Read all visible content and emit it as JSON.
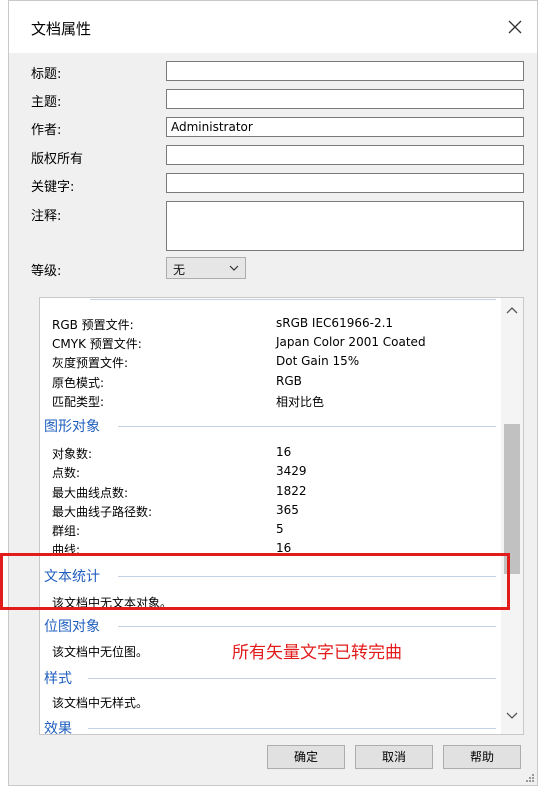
{
  "dialog": {
    "title": "文档属性"
  },
  "fields": {
    "title_label": "标题:",
    "subject_label": "主题:",
    "author_label": "作者:",
    "author_value": "Administrator",
    "copyright_label": "版权所有",
    "keywords_label": "关键字:",
    "comment_label": "注释:",
    "rating_label": "等级:",
    "rating_value": "无"
  },
  "stats": {
    "color": {
      "rows": [
        {
          "label": "RGB 预置文件:",
          "value": "sRGB IEC61966-2.1"
        },
        {
          "label": "CMYK 预置文件:",
          "value": "Japan Color 2001 Coated"
        },
        {
          "label": "灰度预置文件:",
          "value": "Dot Gain 15%"
        },
        {
          "label": "原色模式:",
          "value": "RGB"
        },
        {
          "label": "匹配类型:",
          "value": "相对比色"
        }
      ]
    },
    "graphics": {
      "header": "图形对象",
      "rows": [
        {
          "label": "对象数:",
          "value": "16"
        },
        {
          "label": "点数:",
          "value": "3429"
        },
        {
          "label": "最大曲线点数:",
          "value": "1822"
        },
        {
          "label": "最大曲线子路径数:",
          "value": "365"
        },
        {
          "label": "群组:",
          "value": "5"
        },
        {
          "label": "曲线:",
          "value": "16"
        }
      ]
    },
    "text": {
      "header": "文本统计",
      "note": "该文档中无文本对象。"
    },
    "bitmaps": {
      "header": "位图对象",
      "note": "该文档中无位图。"
    },
    "styles": {
      "header": "样式",
      "note": "该文档中无样式。"
    },
    "effects": {
      "header": "效果"
    }
  },
  "annotation": "所有矢量文字已转完曲",
  "buttons": {
    "ok": "确定",
    "cancel": "取消",
    "help": "帮助"
  },
  "colors": {
    "section_header": "#1f5fbf",
    "annotation": "#e21b1b"
  }
}
